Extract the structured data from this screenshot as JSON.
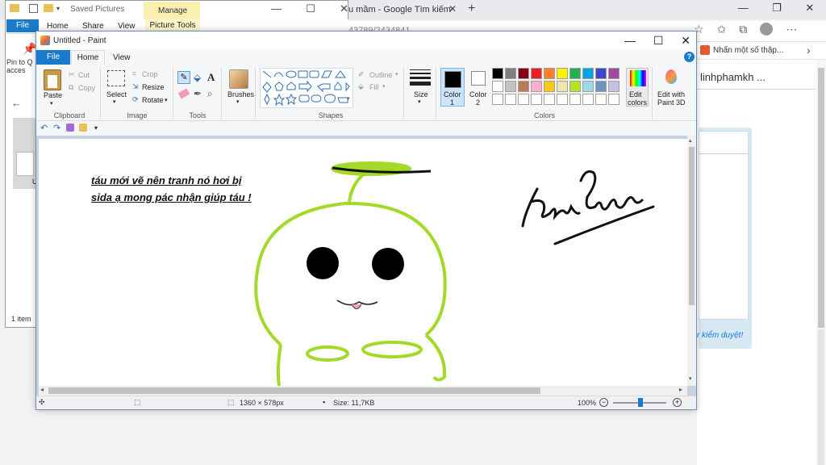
{
  "browser": {
    "tab_title": "u mầm - Google Tìm kiếm",
    "tab_close": "✕",
    "new_tab": "+",
    "address_partial": "43789/2434841",
    "bookmark": "Nhấn một số thập...",
    "content_name": "linhphamkh ...",
    "panel_link": "r kiểm duyệt!",
    "win_min": "—",
    "win_restore": "❐",
    "win_close": "✕"
  },
  "explorer": {
    "title": "Saved Pictures",
    "manage": "Manage",
    "tabs": {
      "file": "File",
      "home": "Home",
      "share": "Share",
      "view": "View",
      "picture_tools": "Picture Tools"
    },
    "pin": "Pin to Q acces",
    "status": "1 item",
    "item_label": "U",
    "ctrl": {
      "min": "—",
      "max": "☐",
      "close": "✕"
    }
  },
  "paint": {
    "title": "Untitled - Paint",
    "ctrl": {
      "min": "—",
      "max": "☐",
      "close": "✕"
    },
    "tabs": {
      "file": "File",
      "home": "Home",
      "view": "View"
    },
    "clipboard": {
      "paste": "Paste",
      "cut": "Cut",
      "copy": "Copy",
      "label": "Clipboard"
    },
    "image": {
      "select": "Select",
      "crop": "Crop",
      "resize": "Resize",
      "rotate": "Rotate",
      "label": "Image"
    },
    "tools": {
      "label": "Tools"
    },
    "brushes": {
      "label": "Brushes"
    },
    "shapes": {
      "outline": "Outline",
      "fill": "Fill",
      "label": "Shapes"
    },
    "size": {
      "label": "Size"
    },
    "color1": {
      "label": "Color",
      "num": "1"
    },
    "color2": {
      "label": "Color",
      "num": "2"
    },
    "edit_colors": {
      "line1": "Edit",
      "line2": "colors"
    },
    "edit_3d": {
      "line1": "Edit with",
      "line2": "Paint 3D"
    },
    "colors_label": "Colors",
    "palette": [
      "#000000",
      "#7f7f7f",
      "#880015",
      "#ed1c24",
      "#ff7f27",
      "#fff200",
      "#22b14c",
      "#00a2e8",
      "#3f48cc",
      "#a349a4",
      "#ffffff",
      "#c3c3c3",
      "#b97a57",
      "#ffaec9",
      "#ffc90e",
      "#efe4b0",
      "#b5e61d",
      "#99d9ea",
      "#7092be",
      "#c8bfe7",
      "#ffffff",
      "#ffffff",
      "#ffffff",
      "#ffffff",
      "#ffffff",
      "#ffffff",
      "#ffffff",
      "#ffffff",
      "#ffffff",
      "#ffffff"
    ],
    "canvas_text_line1": "táu mới vẽ nên tranh nó hơi bị",
    "canvas_text_line2": "sida ạ mong pác nhận giúp táu !",
    "status": {
      "dimensions": "1360 × 578px",
      "size": "Size: 11,7KB",
      "zoom": "100%"
    },
    "colors": {
      "green": "#a3d928",
      "accent": "#1979ca"
    }
  }
}
